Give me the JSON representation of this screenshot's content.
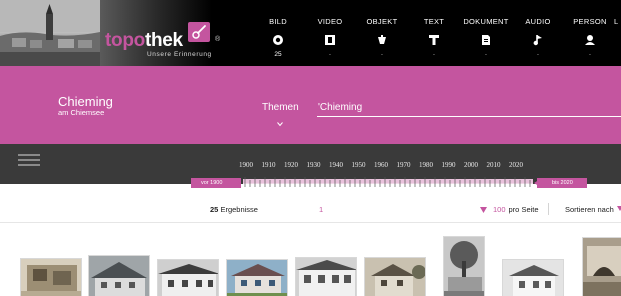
{
  "header": {
    "logo": {
      "prefix": "topo",
      "suffix": "thek",
      "registered": "®",
      "tagline": "Unsere Erinnerung"
    },
    "media_tabs": [
      {
        "label": "BILD",
        "icon": "camera-icon",
        "count": "25"
      },
      {
        "label": "VIDEO",
        "icon": "film-icon",
        "count": "-"
      },
      {
        "label": "OBJEKT",
        "icon": "object-icon",
        "count": "-"
      },
      {
        "label": "TEXT",
        "icon": "text-icon",
        "count": "-"
      },
      {
        "label": "DOKUMENT",
        "icon": "document-icon",
        "count": "-"
      },
      {
        "label": "AUDIO",
        "icon": "music-note-icon",
        "count": "-"
      },
      {
        "label": "PERSON",
        "icon": "person-icon",
        "count": "-"
      }
    ],
    "overflow_letter": "L"
  },
  "place": {
    "title": "Chieming",
    "subtitle": "am Chiemsee"
  },
  "search": {
    "themen_label": "Themen",
    "query": "'Chieming"
  },
  "timeline": {
    "years": [
      "1900",
      "1910",
      "1920",
      "1930",
      "1940",
      "1950",
      "1960",
      "1970",
      "1980",
      "1990",
      "2000",
      "2010",
      "2020"
    ],
    "range_from": "vor 1900",
    "range_to": "bis 2020"
  },
  "results": {
    "count": "25",
    "count_label": "Ergebnisse",
    "page": "1",
    "per_page_value": "100",
    "per_page_label": "pro Seite",
    "sort_label": "Sortieren nach"
  },
  "colors": {
    "accent": "#c4559f",
    "topbar": "#000000",
    "timeline": "#3a3a3a"
  }
}
